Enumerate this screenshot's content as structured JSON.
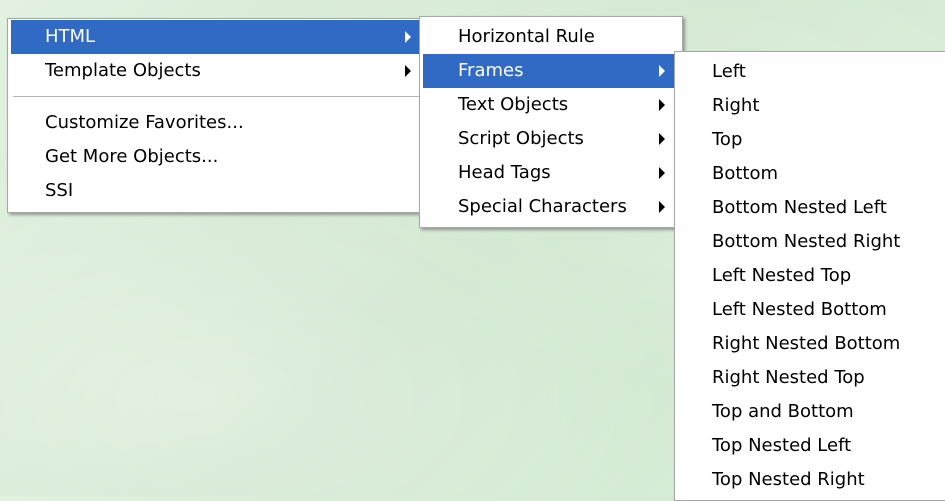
{
  "main_menu": {
    "items": [
      {
        "label": "HTML",
        "has_submenu": true,
        "highlighted": true
      },
      {
        "label": "Template Objects",
        "has_submenu": true,
        "highlighted": false
      },
      {
        "label": "Customize Favorites...",
        "has_submenu": false,
        "highlighted": false
      },
      {
        "label": "Get More Objects...",
        "has_submenu": false,
        "highlighted": false
      },
      {
        "label": "SSI",
        "has_submenu": false,
        "highlighted": false
      }
    ]
  },
  "html_submenu": {
    "items": [
      {
        "label": "Horizontal Rule",
        "has_submenu": false,
        "highlighted": false
      },
      {
        "label": "Frames",
        "has_submenu": true,
        "highlighted": true
      },
      {
        "label": "Text Objects",
        "has_submenu": true,
        "highlighted": false
      },
      {
        "label": "Script Objects",
        "has_submenu": true,
        "highlighted": false
      },
      {
        "label": "Head Tags",
        "has_submenu": true,
        "highlighted": false
      },
      {
        "label": "Special Characters",
        "has_submenu": true,
        "highlighted": false
      }
    ]
  },
  "frames_submenu": {
    "items": [
      {
        "label": "Left"
      },
      {
        "label": "Right"
      },
      {
        "label": "Top"
      },
      {
        "label": "Bottom"
      },
      {
        "label": "Bottom Nested Left"
      },
      {
        "label": "Bottom Nested Right"
      },
      {
        "label": "Left Nested Top"
      },
      {
        "label": "Left Nested Bottom"
      },
      {
        "label": "Right Nested Bottom"
      },
      {
        "label": "Right Nested Top"
      },
      {
        "label": "Top and Bottom"
      },
      {
        "label": "Top Nested Left"
      },
      {
        "label": "Top Nested Right"
      }
    ]
  },
  "colors": {
    "highlight": "#316ac5",
    "menu_background": "#ffffff",
    "desktop_background": "#d7ebd6"
  }
}
